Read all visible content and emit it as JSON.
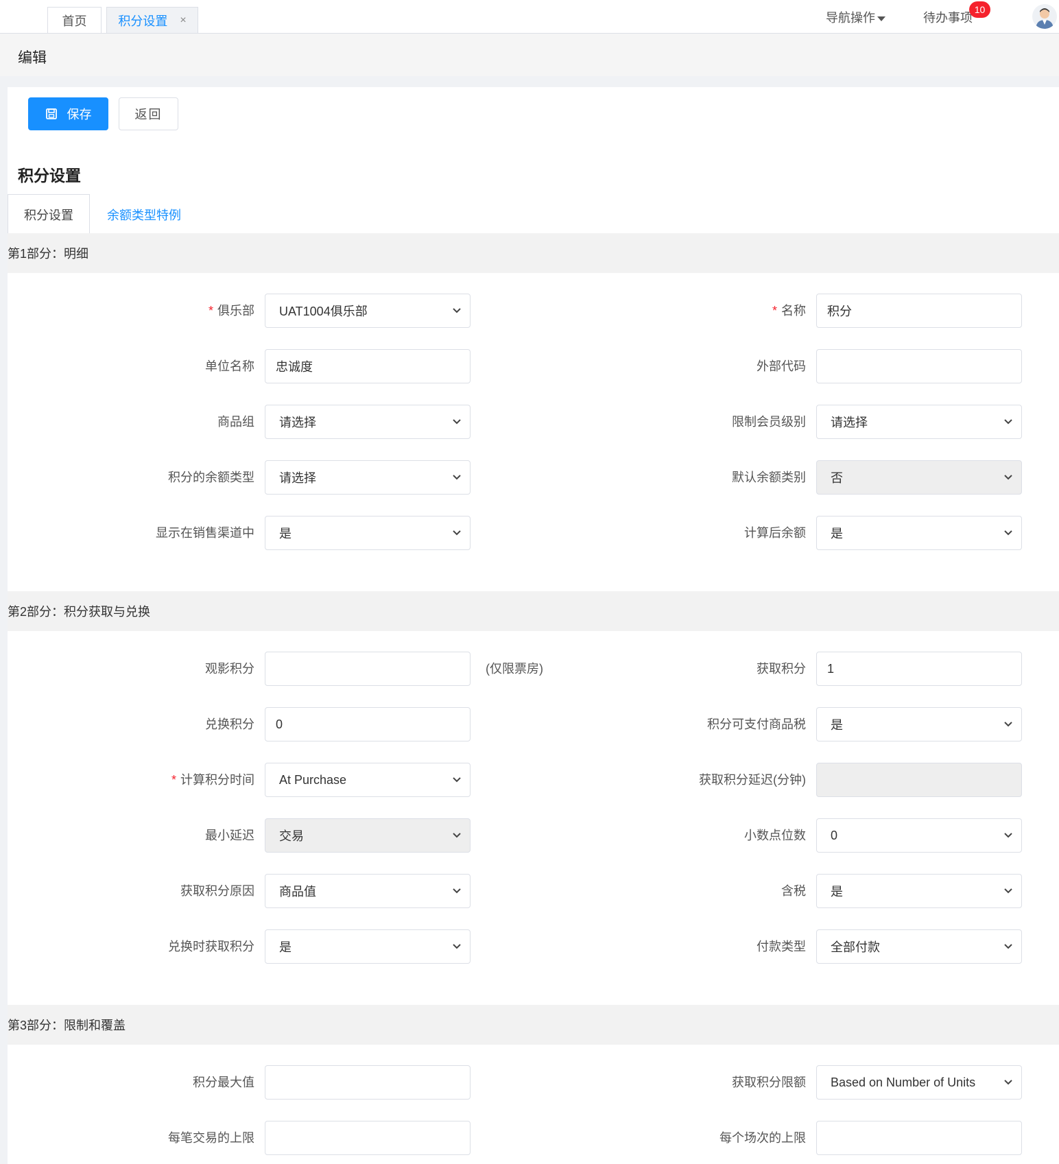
{
  "tabs": {
    "home": "首页",
    "active": "积分设置",
    "close": "×"
  },
  "nav": {
    "ops": "导航操作",
    "todo": "待办事项",
    "badge": "10"
  },
  "page": {
    "title": "编辑",
    "save": "保存",
    "back": "返回",
    "section_title": "积分设置"
  },
  "form_tabs": {
    "tab1": "积分设置",
    "tab2": "余额类型特例"
  },
  "colors": {
    "primary": "#1890ff",
    "required": "#f5222d",
    "badge": "#f5222d"
  },
  "sections": {
    "s1": "第1部分：明细",
    "s2": "第2部分：积分获取与兑换",
    "s3": "第3部分：限制和覆盖"
  },
  "fields": {
    "club": {
      "label": "俱乐部",
      "value": "UAT1004俱乐部"
    },
    "name": {
      "label": "名称",
      "value": "积分"
    },
    "unit_name": {
      "label": "单位名称",
      "value": "忠诚度"
    },
    "ext_code": {
      "label": "外部代码",
      "value": ""
    },
    "product_group": {
      "label": "商品组",
      "value": "请选择"
    },
    "member_level": {
      "label": "限制会员级别",
      "value": "请选择"
    },
    "balance_type": {
      "label": "积分的余额类型",
      "value": "请选择"
    },
    "default_balance": {
      "label": "默认余额类别",
      "value": "否"
    },
    "show_channel": {
      "label": "显示在销售渠道中",
      "value": "是"
    },
    "calc_balance": {
      "label": "计算后余额",
      "value": "是"
    },
    "movie_points": {
      "label": "观影积分",
      "value": "",
      "hint": "(仅限票房)"
    },
    "earn_points": {
      "label": "获取积分",
      "value": "1"
    },
    "redeem_points": {
      "label": "兑换积分",
      "value": "0"
    },
    "pay_tax": {
      "label": "积分可支付商品税",
      "value": "是"
    },
    "calc_time": {
      "label": "计算积分时间",
      "value": "At Purchase"
    },
    "earn_delay": {
      "label": "获取积分延迟(分钟)",
      "value": ""
    },
    "min_delay": {
      "label": "最小延迟",
      "value": "交易"
    },
    "decimals": {
      "label": "小数点位数",
      "value": "0"
    },
    "earn_reason": {
      "label": "获取积分原因",
      "value": "商品值"
    },
    "tax_incl": {
      "label": "含税",
      "value": "是"
    },
    "earn_on_redeem": {
      "label": "兑换时获取积分",
      "value": "是"
    },
    "pay_type": {
      "label": "付款类型",
      "value": "全部付款"
    },
    "max_points": {
      "label": "积分最大值",
      "value": ""
    },
    "earn_limit": {
      "label": "获取积分限额",
      "value": "Based on Number of Units"
    },
    "txn_limit": {
      "label": "每笔交易的上限",
      "value": ""
    },
    "session_limit": {
      "label": "每个场次的上限",
      "value": ""
    }
  }
}
